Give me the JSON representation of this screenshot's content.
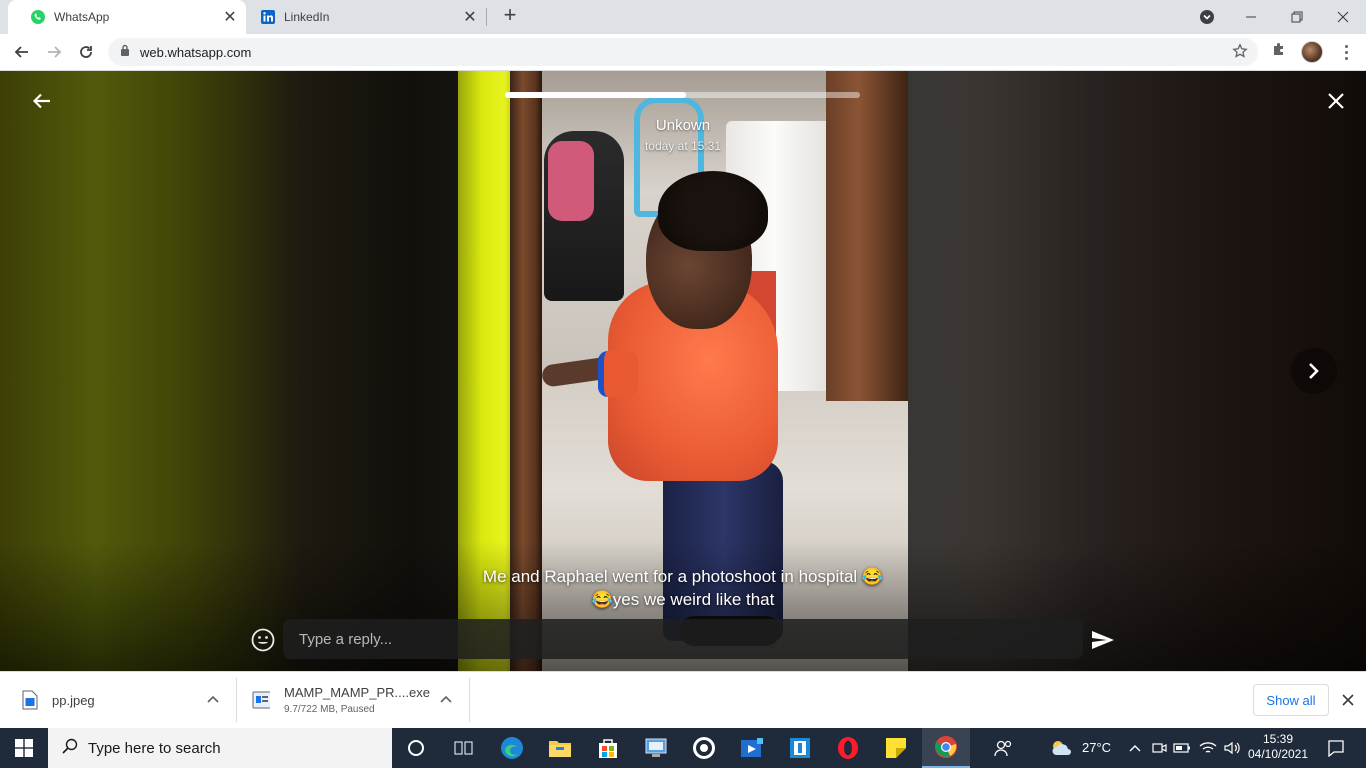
{
  "browser": {
    "tabs": [
      {
        "label": "WhatsApp",
        "icon": "whatsapp-icon",
        "active": true
      },
      {
        "label": "LinkedIn",
        "icon": "linkedin-icon",
        "active": false
      }
    ],
    "url": "web.whatsapp.com"
  },
  "status_viewer": {
    "author": "Unkown",
    "time": "today at 15:31",
    "progress_fraction": 0.51,
    "caption": "Me and Raphael went for a photoshoot in hospital 😂😂yes we weird like that",
    "reply_placeholder": "Type a reply..."
  },
  "downloads": {
    "items": [
      {
        "name": "pp.jpeg",
        "status": ""
      },
      {
        "name": "MAMP_MAMP_PR....exe",
        "status": "9.7/722 MB, Paused"
      }
    ],
    "show_all_label": "Show all"
  },
  "taskbar": {
    "search_placeholder": "Type here to search",
    "weather": "27°C",
    "clock_time": "15:39",
    "clock_date": "04/10/2021"
  },
  "colors": {
    "whatsapp_green": "#25d366",
    "linkedin_blue": "#0a66c2",
    "chrome_link_blue": "#1a73e8",
    "taskbar_bg": "#1f2a3a"
  }
}
